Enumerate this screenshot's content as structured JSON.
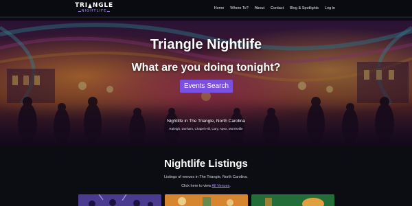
{
  "header": {
    "logo": {
      "line1_a": "TRI",
      "line1_b": "NGLE",
      "line2": "NIGHTLIFE"
    },
    "nav": [
      "Home",
      "Where To?",
      "About",
      "Contact",
      "Blog & Spotlights",
      "Log in"
    ]
  },
  "hero": {
    "title": "Triangle Nightlife",
    "subtitle": "What are you doing tonight?",
    "button_label": "Events Search",
    "location": "Nightlife in The Triangle, North Carolina",
    "cities": "Raleigh, Durham, Chapel Hill, Cary, Apex, Morrisville"
  },
  "listings": {
    "title": "Nightlife Listings",
    "description": "Listings of venues in The Triangle, North Carolina.",
    "cta_prefix": "Click here to view ",
    "cta_link": "All Venues",
    "cta_suffix": "."
  },
  "colors": {
    "accent": "#7b4fe0",
    "link": "#a98aff",
    "logo_accent": "#b592ff",
    "page_bg": "#0c0d12"
  }
}
